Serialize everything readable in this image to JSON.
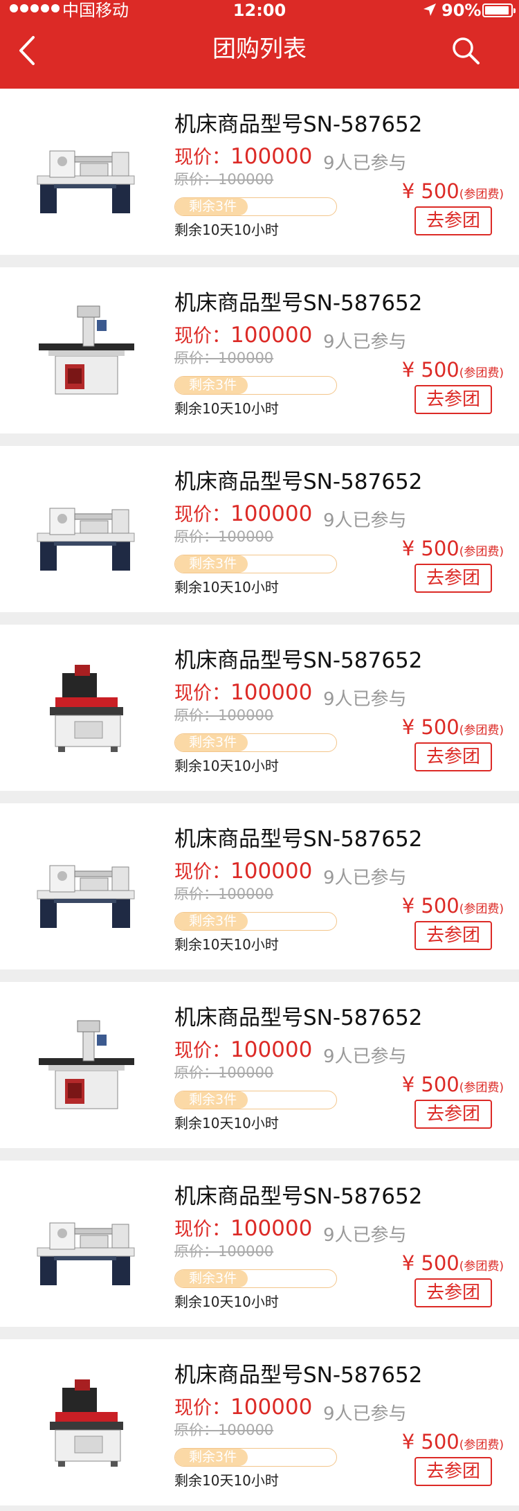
{
  "status_bar": {
    "carrier": "中国移动",
    "time": "12:00",
    "battery": "90%"
  },
  "header": {
    "title": "团购列表",
    "back_icon": "chevron-left-icon",
    "search_icon": "search-icon"
  },
  "colors": {
    "brand_red": "#dc2a26",
    "progress_fill": "#fbd9a6",
    "progress_border": "#f3c58a"
  },
  "items": [
    {
      "title": "机床商品型号SN-587652",
      "price_label": "现价：",
      "price": "100000",
      "original_price": "原价：100000",
      "joined": "9人已参与",
      "remaining_label": "剩余3件",
      "remaining_fraction": 0.45,
      "countdown": "剩余10天10小时",
      "fee": "¥ 500",
      "fee_note": "(参团费)",
      "button": "去参团",
      "image": "lathe-machine"
    },
    {
      "title": "机床商品型号SN-587652",
      "price_label": "现价：",
      "price": "100000",
      "original_price": "原价：100000",
      "joined": "9人已参与",
      "remaining_label": "剩余3件",
      "remaining_fraction": 0.45,
      "countdown": "剩余10天10小时",
      "fee": "¥ 500",
      "fee_note": "(参团费)",
      "button": "去参团",
      "image": "drill-press-machine"
    },
    {
      "title": "机床商品型号SN-587652",
      "price_label": "现价：",
      "price": "100000",
      "original_price": "原价：100000",
      "joined": "9人已参与",
      "remaining_label": "剩余3件",
      "remaining_fraction": 0.45,
      "countdown": "剩余10天10小时",
      "fee": "¥ 500",
      "fee_note": "(参团费)",
      "button": "去参团",
      "image": "lathe-machine"
    },
    {
      "title": "机床商品型号SN-587652",
      "price_label": "现价：",
      "price": "100000",
      "original_price": "原价：100000",
      "joined": "9人已参与",
      "remaining_label": "剩余3件",
      "remaining_fraction": 0.45,
      "countdown": "剩余10天10小时",
      "fee": "¥ 500",
      "fee_note": "(参团费)",
      "button": "去参团",
      "image": "edm-machine"
    },
    {
      "title": "机床商品型号SN-587652",
      "price_label": "现价：",
      "price": "100000",
      "original_price": "原价：100000",
      "joined": "9人已参与",
      "remaining_label": "剩余3件",
      "remaining_fraction": 0.45,
      "countdown": "剩余10天10小时",
      "fee": "¥ 500",
      "fee_note": "(参团费)",
      "button": "去参团",
      "image": "lathe-machine"
    },
    {
      "title": "机床商品型号SN-587652",
      "price_label": "现价：",
      "price": "100000",
      "original_price": "原价：100000",
      "joined": "9人已参与",
      "remaining_label": "剩余3件",
      "remaining_fraction": 0.45,
      "countdown": "剩余10天10小时",
      "fee": "¥ 500",
      "fee_note": "(参团费)",
      "button": "去参团",
      "image": "drill-press-machine"
    },
    {
      "title": "机床商品型号SN-587652",
      "price_label": "现价：",
      "price": "100000",
      "original_price": "原价：100000",
      "joined": "9人已参与",
      "remaining_label": "剩余3件",
      "remaining_fraction": 0.45,
      "countdown": "剩余10天10小时",
      "fee": "¥ 500",
      "fee_note": "(参团费)",
      "button": "去参团",
      "image": "lathe-machine"
    },
    {
      "title": "机床商品型号SN-587652",
      "price_label": "现价：",
      "price": "100000",
      "original_price": "原价：100000",
      "joined": "9人已参与",
      "remaining_label": "剩余3件",
      "remaining_fraction": 0.45,
      "countdown": "剩余10天10小时",
      "fee": "¥ 500",
      "fee_note": "(参团费)",
      "button": "去参团",
      "image": "edm-machine"
    }
  ]
}
